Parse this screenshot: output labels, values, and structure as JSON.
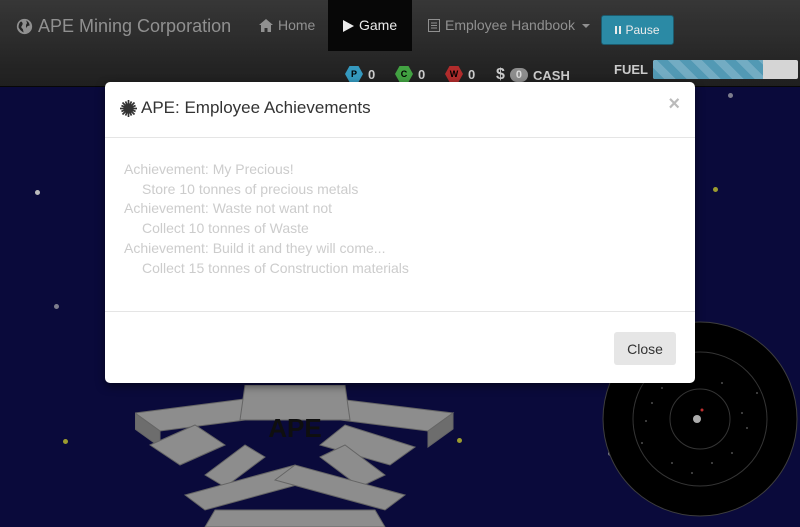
{
  "navbar": {
    "brand": "APE Mining Corporation",
    "home_label": "Home",
    "game_label": "Game",
    "handbook_label": "Employee Handbook",
    "pause_label": "Pause"
  },
  "resources": [
    {
      "letter": "P",
      "value": "0",
      "color": "#3aa6d0"
    },
    {
      "letter": "C",
      "value": "0",
      "color": "#48b048"
    },
    {
      "letter": "W",
      "value": "0",
      "color": "#c03030"
    }
  ],
  "cash": {
    "symbol": "$",
    "value": "0",
    "label": "CASH"
  },
  "fuel": {
    "label": "FUEL",
    "level": 0.76
  },
  "station_label": "APE",
  "modal": {
    "title": "APE: Employee Achievements",
    "close_x": "×",
    "close_button": "Close",
    "achievements": [
      {
        "title": "Achievement: My Precious!",
        "desc": "Store 10 tonnes of precious metals"
      },
      {
        "title": "Achievement: Waste not want not",
        "desc": "Collect 10 tonnes of Waste"
      },
      {
        "title": "Achievement: Build it and they will come...",
        "desc": "Collect 15 tonnes of Construction materials"
      }
    ]
  },
  "colors": {
    "space": "#0b0b40",
    "accent": "#2f96b4"
  }
}
